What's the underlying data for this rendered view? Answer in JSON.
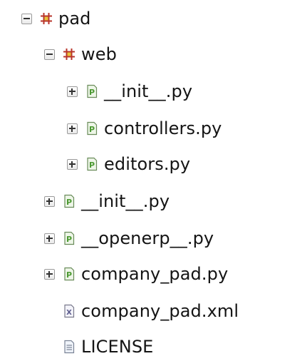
{
  "tree": {
    "items": [
      {
        "label": "pad",
        "toggle": "minus",
        "icon": "package-icon"
      },
      {
        "label": "web",
        "toggle": "minus",
        "icon": "package-icon"
      },
      {
        "label": "__init__.py",
        "toggle": "plus",
        "icon": "python-file-icon"
      },
      {
        "label": "controllers.py",
        "toggle": "plus",
        "icon": "python-file-icon"
      },
      {
        "label": "editors.py",
        "toggle": "plus",
        "icon": "python-file-icon"
      },
      {
        "label": "__init__.py",
        "toggle": "plus",
        "icon": "python-file-icon"
      },
      {
        "label": "__openerp__.py",
        "toggle": "plus",
        "icon": "python-file-icon"
      },
      {
        "label": "company_pad.py",
        "toggle": "plus",
        "icon": "python-file-icon"
      },
      {
        "label": "company_pad.xml",
        "toggle": "none",
        "icon": "xml-file-icon"
      },
      {
        "label": "LICENSE",
        "toggle": "none",
        "icon": "text-file-icon"
      }
    ]
  },
  "colors": {
    "package_icon": "#b8352b",
    "python_icon": "#4c9a32",
    "xml_icon": "#5a5a8c",
    "toggle_border": "#9a9a9a",
    "text": "#141414"
  }
}
